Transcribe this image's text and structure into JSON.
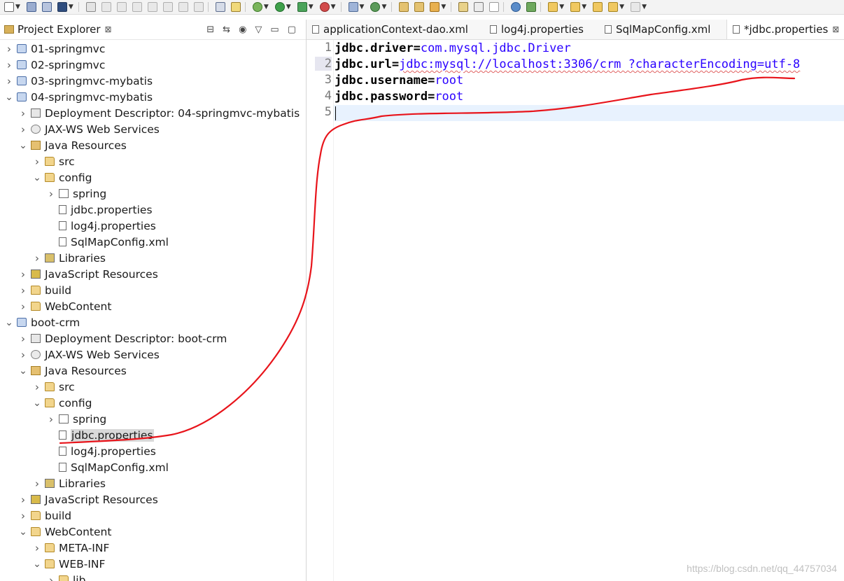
{
  "project_explorer": {
    "title": "Project Explorer",
    "close_glyph": "⊠",
    "tree": [
      {
        "label": "01-springmvc",
        "indent": 0,
        "twisty": "closed",
        "icon": "project-icon",
        "cls": "ic-project"
      },
      {
        "label": "02-springmvc",
        "indent": 0,
        "twisty": "closed",
        "icon": "project-icon",
        "cls": "ic-project"
      },
      {
        "label": "03-springmvc-mybatis",
        "indent": 0,
        "twisty": "closed",
        "icon": "project-icon",
        "cls": "ic-project"
      },
      {
        "label": "04-springmvc-mybatis",
        "indent": 0,
        "twisty": "open",
        "icon": "project-icon",
        "cls": "ic-project"
      },
      {
        "label": "Deployment Descriptor: 04-springmvc-mybatis",
        "indent": 1,
        "twisty": "closed",
        "icon": "deployment-descriptor-icon",
        "cls": "ic-descriptor"
      },
      {
        "label": "JAX-WS Web Services",
        "indent": 1,
        "twisty": "closed",
        "icon": "web-services-icon",
        "cls": "ic-ws"
      },
      {
        "label": "Java Resources",
        "indent": 1,
        "twisty": "open",
        "icon": "java-resources-icon",
        "cls": "ic-javares"
      },
      {
        "label": "src",
        "indent": 2,
        "twisty": "closed",
        "icon": "source-folder-icon",
        "cls": "ic-folder"
      },
      {
        "label": "config",
        "indent": 2,
        "twisty": "open",
        "icon": "source-folder-icon",
        "cls": "ic-folder"
      },
      {
        "label": "spring",
        "indent": 3,
        "twisty": "closed",
        "icon": "package-icon",
        "cls": "ic-package"
      },
      {
        "label": "jdbc.properties",
        "indent": 3,
        "twisty": "none",
        "icon": "properties-file-icon",
        "cls": "ic-file"
      },
      {
        "label": "log4j.properties",
        "indent": 3,
        "twisty": "none",
        "icon": "properties-file-icon",
        "cls": "ic-file"
      },
      {
        "label": "SqlMapConfig.xml",
        "indent": 3,
        "twisty": "none",
        "icon": "xml-file-icon",
        "cls": "ic-xml"
      },
      {
        "label": "Libraries",
        "indent": 2,
        "twisty": "closed",
        "icon": "libraries-icon",
        "cls": "ic-lib"
      },
      {
        "label": "JavaScript Resources",
        "indent": 1,
        "twisty": "closed",
        "icon": "javascript-resources-icon",
        "cls": "ic-jsres"
      },
      {
        "label": "build",
        "indent": 1,
        "twisty": "closed",
        "icon": "folder-icon",
        "cls": "ic-folder"
      },
      {
        "label": "WebContent",
        "indent": 1,
        "twisty": "closed",
        "icon": "folder-icon",
        "cls": "ic-folder"
      },
      {
        "label": "boot-crm",
        "indent": 0,
        "twisty": "open",
        "icon": "project-icon",
        "cls": "ic-project"
      },
      {
        "label": "Deployment Descriptor: boot-crm",
        "indent": 1,
        "twisty": "closed",
        "icon": "deployment-descriptor-icon",
        "cls": "ic-descriptor"
      },
      {
        "label": "JAX-WS Web Services",
        "indent": 1,
        "twisty": "closed",
        "icon": "web-services-icon",
        "cls": "ic-ws"
      },
      {
        "label": "Java Resources",
        "indent": 1,
        "twisty": "open",
        "icon": "java-resources-icon",
        "cls": "ic-javares"
      },
      {
        "label": "src",
        "indent": 2,
        "twisty": "closed",
        "icon": "source-folder-icon",
        "cls": "ic-folder"
      },
      {
        "label": "config",
        "indent": 2,
        "twisty": "open",
        "icon": "source-folder-icon",
        "cls": "ic-folder"
      },
      {
        "label": "spring",
        "indent": 3,
        "twisty": "closed",
        "icon": "package-icon",
        "cls": "ic-package"
      },
      {
        "label": "jdbc.properties",
        "indent": 3,
        "twisty": "none",
        "icon": "properties-file-icon",
        "cls": "ic-file",
        "selected": true
      },
      {
        "label": "log4j.properties",
        "indent": 3,
        "twisty": "none",
        "icon": "properties-file-icon",
        "cls": "ic-file"
      },
      {
        "label": "SqlMapConfig.xml",
        "indent": 3,
        "twisty": "none",
        "icon": "xml-file-icon",
        "cls": "ic-xml"
      },
      {
        "label": "Libraries",
        "indent": 2,
        "twisty": "closed",
        "icon": "libraries-icon",
        "cls": "ic-lib"
      },
      {
        "label": "JavaScript Resources",
        "indent": 1,
        "twisty": "closed",
        "icon": "javascript-resources-icon",
        "cls": "ic-jsres"
      },
      {
        "label": "build",
        "indent": 1,
        "twisty": "closed",
        "icon": "folder-icon",
        "cls": "ic-folder"
      },
      {
        "label": "WebContent",
        "indent": 1,
        "twisty": "open",
        "icon": "folder-icon",
        "cls": "ic-folder"
      },
      {
        "label": "META-INF",
        "indent": 2,
        "twisty": "closed",
        "icon": "folder-icon",
        "cls": "ic-folder"
      },
      {
        "label": "WEB-INF",
        "indent": 2,
        "twisty": "open",
        "icon": "folder-icon",
        "cls": "ic-folder"
      },
      {
        "label": "lib",
        "indent": 3,
        "twisty": "closed",
        "icon": "folder-icon",
        "cls": "ic-folder"
      }
    ]
  },
  "editor": {
    "tabs": [
      {
        "label": "applicationContext-dao.xml",
        "icon": "xml-file-icon",
        "active": false
      },
      {
        "label": "log4j.properties",
        "icon": "properties-file-icon",
        "active": false
      },
      {
        "label": "SqlMapConfig.xml",
        "icon": "xml-file-icon",
        "active": false
      },
      {
        "label": "*jdbc.properties",
        "icon": "properties-file-icon",
        "active": true
      }
    ],
    "tab_close_glyph": "⊠",
    "lines": [
      {
        "number": "1",
        "key": "jdbc.driver",
        "value": "com.mysql.jdbc.Driver",
        "squiggle": false
      },
      {
        "number": "2",
        "key": "jdbc.url",
        "value": "jdbc:mysql://localhost:3306/crm ?characterEncoding=utf-8",
        "squiggle": true
      },
      {
        "number": "3",
        "key": "jdbc.username",
        "value": "root",
        "squiggle": false
      },
      {
        "number": "4",
        "key": "jdbc.password",
        "value": "root",
        "squiggle": false
      },
      {
        "number": "5",
        "key": "",
        "value": "",
        "squiggle": false
      }
    ],
    "separator": "="
  },
  "watermark": "https://blog.csdn.net/qq_44757034",
  "colors": {
    "value_blue": "#2a00ff",
    "annotation_red": "#e8141b",
    "current_line": "#e8f2fe",
    "selection": "#d9d9d9"
  }
}
